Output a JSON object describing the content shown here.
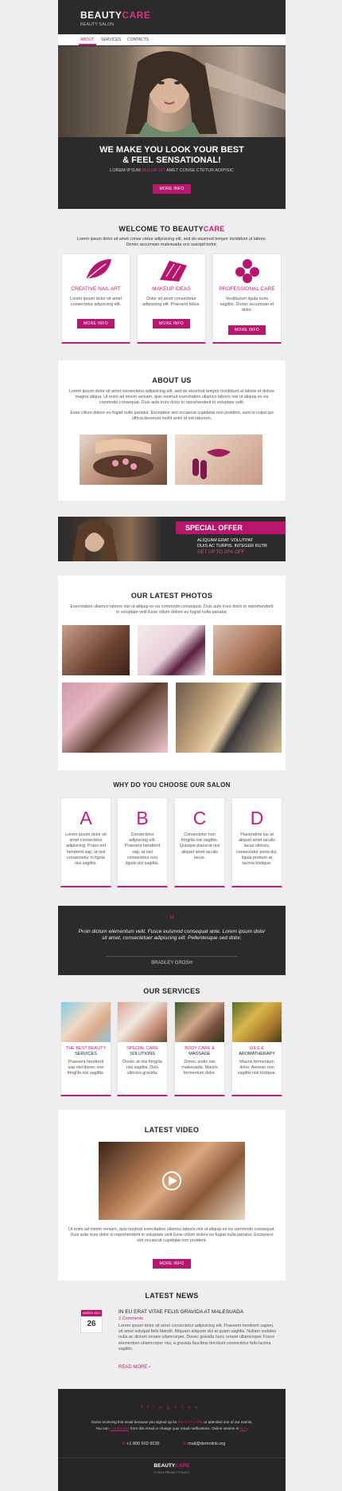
{
  "header": {
    "logo_part1": "BEAUTY",
    "logo_part2": "CARE",
    "subtitle": "BEAUTY SALON",
    "nav": [
      "ABOUT",
      "SERVICES",
      "CONTACTS"
    ]
  },
  "hero": {
    "title_line1": "WE MAKE YOU LOOK YOUR BEST",
    "title_line2": "& FEEL SENSATIONAL!",
    "tagline_1": "LOREM IPSUM ",
    "tagline_2": "DOLOR SIT",
    "tagline_3": " AMET CONSE CTETUR ADIPISIC",
    "button": "MORE INFO"
  },
  "welcome": {
    "title_1": "WELCOME TO ",
    "title_2": "BEAUTY",
    "title_3": "CARE",
    "text": "Lorem ipsum dolor sit amet conse ctetur adipisicing elit, sed do eiusmod tempor incididunt ut labore. Donec accumsan malesuada orci suscipit tortor.",
    "features": [
      {
        "title": "CREATIVE NAIL ART",
        "text": "Lorem ipsum dolor sit amet consectetur adipiscing elit.",
        "button": "MORE INFO",
        "icon": "leaf-icon"
      },
      {
        "title": "MAKEUP IDEAS",
        "text": "Dolor sit amet consectetur adipiscing elit. Praesent tellus.",
        "button": "MORE INFO",
        "icon": "brush-icon"
      },
      {
        "title": "PROFESSIONAL CARE",
        "text": "Vestibulum ligula nunc sagittis. Donec accumsan et dolor.",
        "button": "MORE INFO",
        "icon": "flower-icon"
      }
    ]
  },
  "about": {
    "title": "ABOUT US",
    "text1": "Lorem ipsum dolor sit amet consectetur adipisicing elit, sed do eiusmod tempor incididunt ut labore et dolore magna aliqua. Ut enim ad minim veniam, quis nostrud exercitation ullamco laboris nisi ut aliquip ex ea commodo consequat. Duis aute irure dolor in reprehenderit in voluptate velit.",
    "text2": "Esse cillum dolore eu fugiat nulla pariatur. Excepteur sint occaecat cupidatat non proident, sunt in culpa qui officia deserunt mollit anim id est laborum."
  },
  "special_offer": {
    "title": "SPECIAL OFFER",
    "line1": "ALIQUAM ERAT VOLUTPAT",
    "line2": "DUIS AC TURPIS. INTEGER RUTR",
    "line3": "GET UP TO 20% OFF"
  },
  "photos": {
    "title": "OUR LATEST PHOTOS",
    "text": "Exercitation ullamco laboris nisi ut aliquip ex ea commodo consequat. Duis aute irure dolor in reprehenderit in voluptate velit Esse cillum dolore eu fugiat nulla pariatur."
  },
  "why": {
    "title": "WHY DO YOU CHOOSE OUR SALON",
    "items": [
      {
        "letter": "A",
        "text": "Lorem ipsum dolor sit amet consectetur adipiscing. Praes ent hendrerit sap, at nisl consectetur ni ligula nisi sagittis."
      },
      {
        "letter": "B",
        "text": "Consectetur adipiscing elit. Praesent hendrerit sap, at nisl consectetur non ligula nisi sagittis."
      },
      {
        "letter": "C",
        "text": "Consectetur non fringilla nisi sagittis. Quisque placerat nisi aliquet amet iaculis lacus."
      },
      {
        "letter": "D",
        "text": "Placeratme ius at aliquet amet iaculis lacus ultrices, consectetur porta dui, ligula pretium at lacinia tristique."
      }
    ]
  },
  "quote": {
    "mark": "“",
    "text": "Proin dictum elementum velit. Fusce euismod consequat ante. Lorem ipsum dolor sit amet, consectetuer adipiscing elit. Pellentesque sed dolor.",
    "author": "BRADLEY GROSH"
  },
  "services": {
    "title": "OUR SERVICES",
    "items": [
      {
        "title1": "THE BEST BEAUTY",
        "title2": "SERVICES",
        "text": "Praesent hendrerit sap nisl donec non fringilla nisi sagittis."
      },
      {
        "title1": "SPECIAL CARE",
        "title2": "SOLUTIONS",
        "text": "Donec at nisi fringilla nisi sagittis. Duis ultricies gravida."
      },
      {
        "title1": "BODY CARE &",
        "title2": "MASSAGE",
        "text": "Donec sodis nisi malesuada. Mauris fermentum dolor."
      },
      {
        "title1": "OILS &",
        "title2": "AROMATHERAPY",
        "text": "Mauris fermentum dolor. Aenean non sagittis nisi tristique."
      }
    ]
  },
  "video": {
    "title": "LATEST VIDEO",
    "text": "Ut enim ad minim veniam, quis nostrud exercitation ullamco laboris nisi ut aliquip ex ea commodo consequat. Duis aute irure dolor in reprehenderit in voluptate velit Esse cillum dolore eu fugiat nulla pariatur. Excepteur sint occaecat cupidatat non proident.",
    "button": "MORE INFO"
  },
  "news": {
    "title": "LATEST NEWS",
    "month": "MARCH 2014",
    "day": "26",
    "headline": "IN EU ERAT VITAE FELIS GRAVIDA AT MALESUADA",
    "comments": "2 Comments",
    "text": "Lorem ipsum dolor sit amet consectetur adipisicing elit. Praesent hendrerit sapien, sit amet volutpat felis blandit. Aliquam aliquam dui at quam sagittis. Nullam sodales nulla ac dictum ornare ullamcorper. Donec gravida nunc ornare ullamcorper Fusce elementum ullamcorper nisi, a gravida faucibus tincidunt consectetur felis lacinia sagittis.",
    "read_more": "READ MORE"
  },
  "footer": {
    "social": [
      "f",
      "t",
      "in",
      "g+",
      "rss"
    ],
    "line1_a": "You're receiving this email because you signed up for ",
    "line1_b": "BEAUTYCARE",
    "line1_c": " or attended one of our events.",
    "line2_a": "You can ",
    "line2_link": "unsubscribe",
    "line2_b": " from this email or change your email notifications. Online version is ",
    "line2_link2": "here",
    "line2_c": ".",
    "phone": "+1 800 603 6035",
    "email": "mail@demolink.org",
    "logo_1": "BEAUTY",
    "logo_2": "CARE",
    "copyright": "© 2014 PRIVACY POLICY"
  },
  "colors": {
    "accent": "#c41e7b",
    "dark": "#2b2b2b",
    "background": "#eeeeee"
  }
}
